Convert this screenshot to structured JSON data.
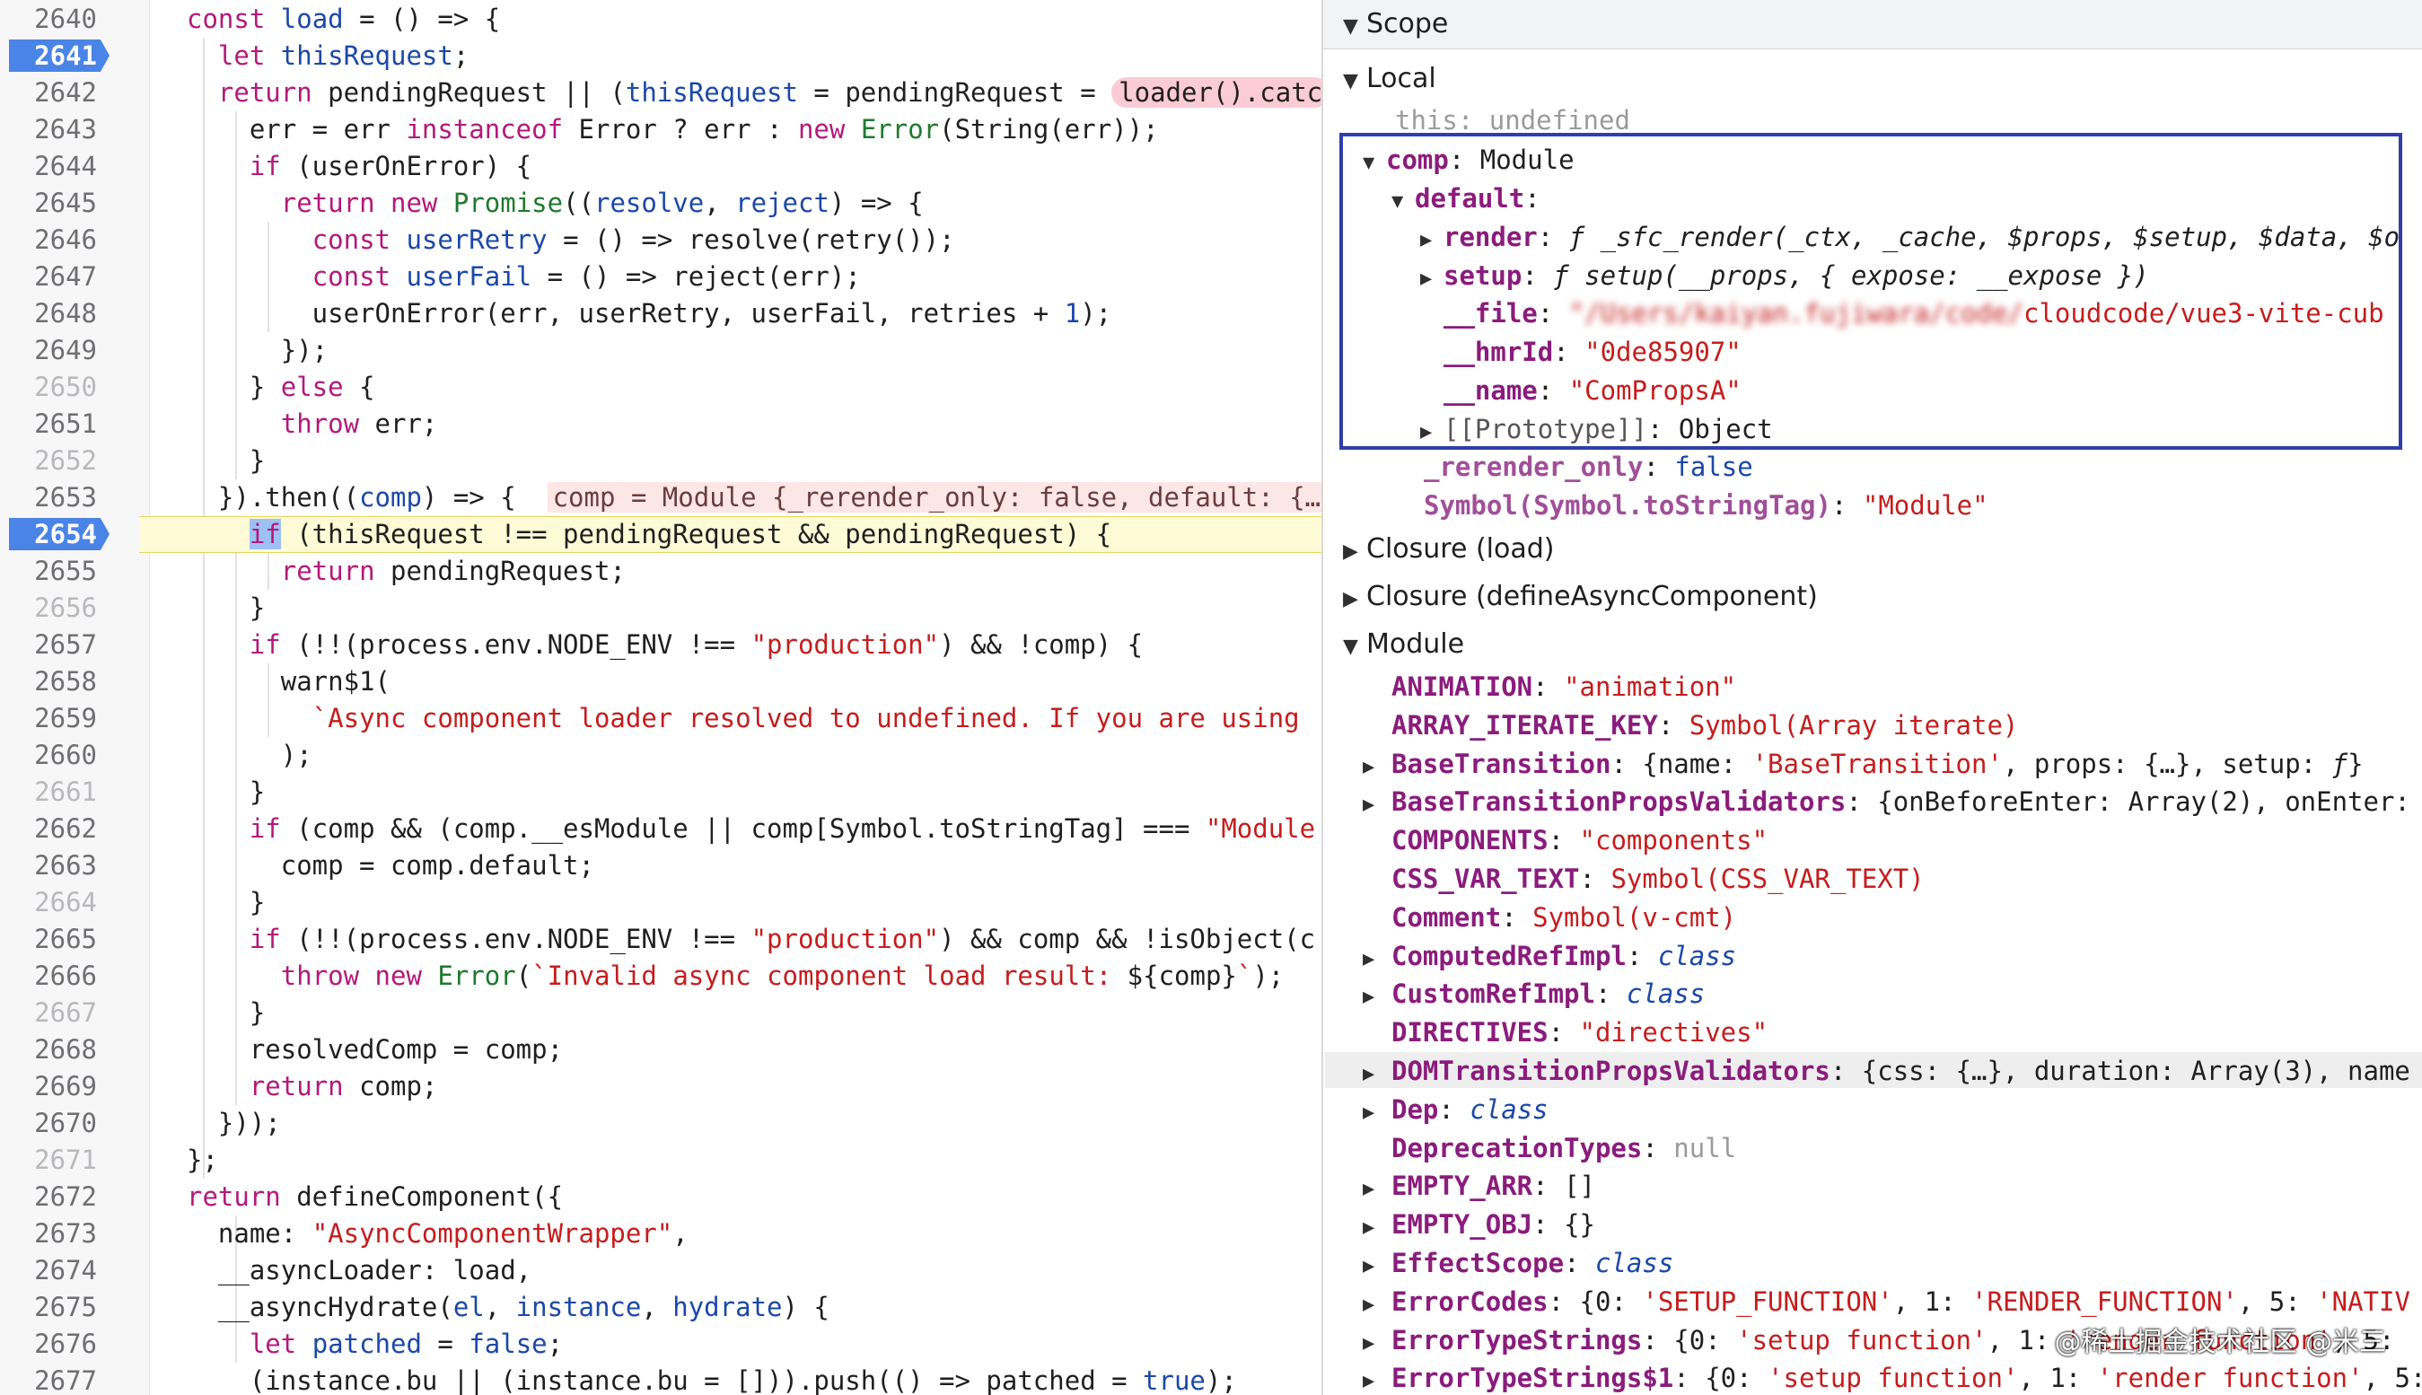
{
  "editor": {
    "lines": [
      {
        "n": "2640",
        "html": "<span class='kw'>const</span> <span class='var'>load</span> = () =&gt; {"
      },
      {
        "n": "2641",
        "bp": true,
        "html": "  <span class='kw'>let</span> <span class='var'>thisRequest</span>;"
      },
      {
        "n": "2642",
        "html": "  <span class='kw'>return</span> pendingRequest || (<span class='var'>thisRequest</span> = pendingRequest = <span class='pill'>loader().catc</span>"
      },
      {
        "n": "2643",
        "html": "    err = err <span class='kw'>instanceof</span> Error ? err : <span class='kw'>new</span> <span class='cls'>Error</span>(String(err));"
      },
      {
        "n": "2644",
        "html": "    <span class='kw'>if</span> (userOnError) {"
      },
      {
        "n": "2645",
        "html": "      <span class='kw'>return</span> <span class='kw'>new</span> <span class='cls'>Promise</span>((<span class='var'>resolve</span>, <span class='var'>reject</span>) =&gt; {"
      },
      {
        "n": "2646",
        "html": "        <span class='kw'>const</span> <span class='var'>userRetry</span> = () =&gt; resolve(retry());"
      },
      {
        "n": "2647",
        "html": "        <span class='kw'>const</span> <span class='var'>userFail</span> = () =&gt; reject(err);"
      },
      {
        "n": "2648",
        "html": "        userOnError(err, userRetry, userFail, retries + <span class='num'>1</span>);"
      },
      {
        "n": "2649",
        "html": "      });"
      },
      {
        "n": "2650",
        "dim": true,
        "html": "    } <span class='kw'>else</span> {"
      },
      {
        "n": "2651",
        "html": "      <span class='kw'>throw</span> err;"
      },
      {
        "n": "2652",
        "dim": true,
        "html": "    }"
      },
      {
        "n": "2653",
        "html": "  }).then((<span class='var'>comp</span>) =&gt; {  <span class='inline-val'>comp = Module {_rerender_only: false, default: {…</span>"
      },
      {
        "n": "2654",
        "bp": true,
        "paused": true,
        "html": "    <span class='cur'>if</span> (thisRequest !== pendingRequest &amp;&amp; pendingRequest) {"
      },
      {
        "n": "2655",
        "html": "      <span class='kw'>return</span> pendingRequest;"
      },
      {
        "n": "2656",
        "dim": true,
        "html": "    }"
      },
      {
        "n": "2657",
        "html": "    <span class='kw'>if</span> (!!(process.env.NODE_ENV !== <span class='str'>\"production\"</span>) &amp;&amp; !comp) {"
      },
      {
        "n": "2658",
        "html": "      warn$1("
      },
      {
        "n": "2659",
        "html": "        <span class='str'>`Async component loader resolved to undefined. If you are using</span>"
      },
      {
        "n": "2660",
        "html": "      );"
      },
      {
        "n": "2661",
        "dim": true,
        "html": "    }"
      },
      {
        "n": "2662",
        "html": "    <span class='kw'>if</span> (comp &amp;&amp; (comp.__esModule || comp[Symbol.toStringTag] === <span class='str'>\"Module</span>"
      },
      {
        "n": "2663",
        "html": "      comp = comp.default;"
      },
      {
        "n": "2664",
        "dim": true,
        "html": "    }"
      },
      {
        "n": "2665",
        "html": "    <span class='kw'>if</span> (!!(process.env.NODE_ENV !== <span class='str'>\"production\"</span>) &amp;&amp; comp &amp;&amp; !isObject(c"
      },
      {
        "n": "2666",
        "html": "      <span class='kw'>throw</span> <span class='kw'>new</span> <span class='cls'>Error</span>(<span class='str'>`Invalid async component load result: </span>${comp}<span class='str'>`</span>);"
      },
      {
        "n": "2667",
        "dim": true,
        "html": "    }"
      },
      {
        "n": "2668",
        "html": "    resolvedComp = comp;"
      },
      {
        "n": "2669",
        "html": "    <span class='kw'>return</span> comp;"
      },
      {
        "n": "2670",
        "html": "  }));"
      },
      {
        "n": "2671",
        "dim": true,
        "html": "};"
      },
      {
        "n": "2672",
        "html": "<span class='kw'>return</span> defineComponent({"
      },
      {
        "n": "2673",
        "html": "  name: <span class='str'>\"AsyncComponentWrapper\"</span>,"
      },
      {
        "n": "2674",
        "html": "  __asyncLoader: load,"
      },
      {
        "n": "2675",
        "html": "  __asyncHydrate(<span class='var'>el</span>, <span class='var'>instance</span>, <span class='var'>hydrate</span>) {"
      },
      {
        "n": "2676",
        "html": "    <span class='kw'>let</span> <span class='var'>patched</span> = <span class='kwv'>false</span>;"
      },
      {
        "n": "2677",
        "html": "    (instance.bu || (instance.bu = [])).push(() =&gt; patched = <span class='kwv'>true</span>);"
      }
    ]
  },
  "scope": {
    "title": "Scope",
    "local_label": "Local",
    "this_key": "this",
    "this_val": "undefined",
    "comp_key": "comp",
    "comp_val": "Module",
    "default_key": "default",
    "render_key": "render",
    "render_val": "ƒ _sfc_render(_ctx, _cache, $props, $setup, $data, $o",
    "setup_key": "setup",
    "setup_val": "ƒ setup(__props, { expose: __expose })",
    "file_key": "__file",
    "file_val_blur": "\"/Users/kaiyan.fujiwara/code/",
    "file_val_tail": "cloudcode/vue3-vite-cub",
    "hmrid_key": "__hmrId",
    "hmrid_val": "\"0de85907\"",
    "name_key": "__name",
    "name_val": "\"ComPropsA\"",
    "proto_key": "[[Prototype]]",
    "proto_val": "Object",
    "rerender_key": "_rerender_only",
    "rerender_val": "false",
    "symbol_key": "Symbol(Symbol.toStringTag)",
    "symbol_val": "\"Module\"",
    "closure_load": "Closure (load)",
    "closure_define": "Closure (defineAsyncComponent)",
    "module_label": "Module",
    "module_items": [
      {
        "key": "ANIMATION",
        "html": "<span class='s'>\"animation\"</span>",
        "expand": false
      },
      {
        "key": "ARRAY_ITERATE_KEY",
        "html": "<span class='s'>Symbol(Array iterate)</span>",
        "expand": false
      },
      {
        "key": "BaseTransition",
        "html": "{name: <span class='s'>'BaseTransition'</span>, props: {…}, setup: <span class='it'>ƒ</span>}",
        "expand": true
      },
      {
        "key": "BaseTransitionPropsValidators",
        "html": "{onBeforeEnter: Array(2), onEnter:",
        "expand": true
      },
      {
        "key": "COMPONENTS",
        "html": "<span class='s'>\"components\"</span>",
        "expand": false
      },
      {
        "key": "CSS_VAR_TEXT",
        "html": "<span class='s'>Symbol(CSS_VAR_TEXT)</span>",
        "expand": false
      },
      {
        "key": "Comment",
        "html": "<span class='s'>Symbol(v-cmt)</span>",
        "expand": false
      },
      {
        "key": "ComputedRefImpl",
        "html": "<span class='cn'>class</span>",
        "expand": true
      },
      {
        "key": "CustomRefImpl",
        "html": "<span class='cn'>class</span>",
        "expand": true
      },
      {
        "key": "DIRECTIVES",
        "html": "<span class='s'>\"directives\"</span>",
        "expand": false
      },
      {
        "key": "DOMTransitionPropsValidators",
        "html": "{css: {…}, duration: Array(3), name",
        "expand": true
      },
      {
        "key": "Dep",
        "html": "<span class='cn'>class</span>",
        "expand": true
      },
      {
        "key": "DeprecationTypes",
        "html": "<span class='muted'>null</span>",
        "expand": false
      },
      {
        "key": "EMPTY_ARR",
        "html": "[]",
        "expand": true
      },
      {
        "key": "EMPTY_OBJ",
        "html": "{}",
        "expand": true
      },
      {
        "key": "EffectScope",
        "html": "<span class='cn'>class</span>",
        "expand": true
      },
      {
        "key": "ErrorCodes",
        "html": "{0: <span class='s'>'SETUP_FUNCTION'</span>, 1: <span class='s'>'RENDER_FUNCTION'</span>, 5: <span class='s'>'NATIV</span>",
        "expand": true
      },
      {
        "key": "ErrorTypeStrings",
        "html": "{0: <span class='s'>'setup function'</span>, 1: <span class='s'>'render function'</span>, 5:",
        "expand": true
      },
      {
        "key": "ErrorTypeStrings$1",
        "html": "{0: <span class='s'>'setup function'</span>, 1: <span class='s'>'render function'</span>, 5:",
        "expand": true
      }
    ]
  },
  "watermark": "@稀土掘金技术社区 @米三"
}
